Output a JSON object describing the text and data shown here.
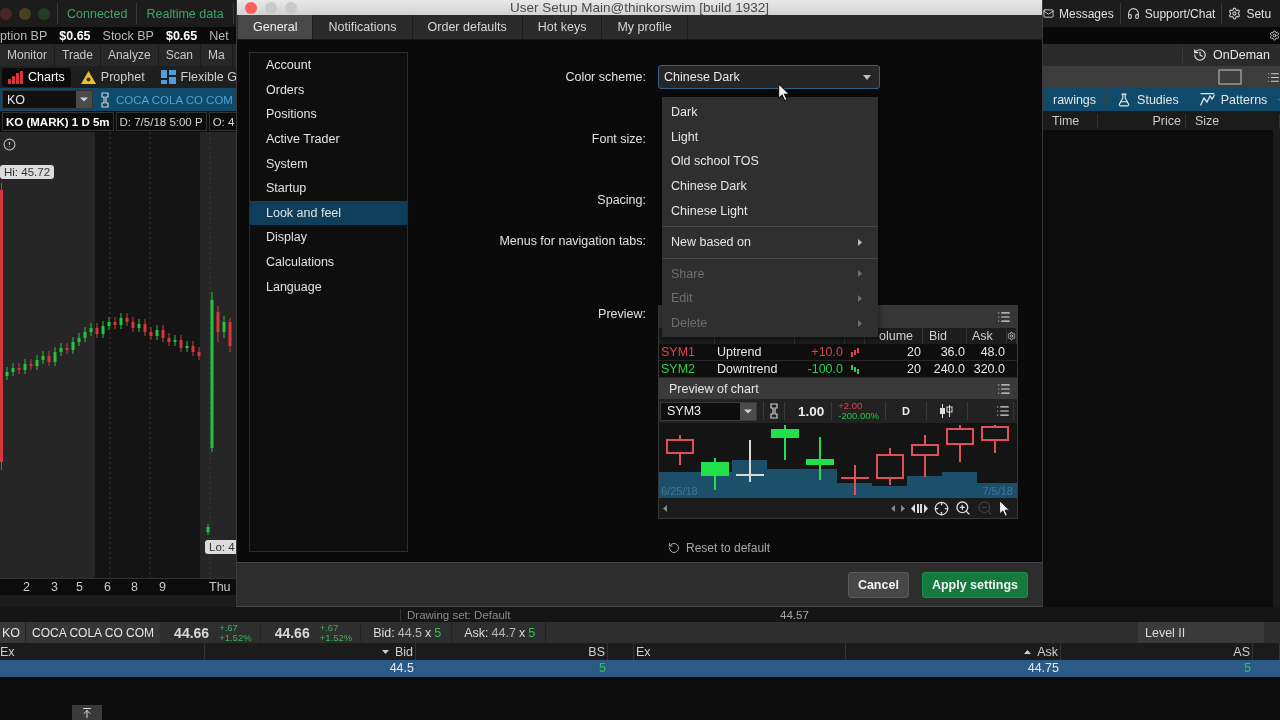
{
  "main_window": {
    "status": {
      "connection": "Connected",
      "feed": "Realtime data"
    },
    "balances": [
      {
        "label": "ption BP",
        "value": "$0.65"
      },
      {
        "label": "Stock BP",
        "value": "$0.65"
      },
      {
        "label": "Net"
      }
    ],
    "header_links": [
      {
        "label": "Messages"
      },
      {
        "label": "Support/Chat"
      },
      {
        "label": "Setu"
      }
    ],
    "main_tabs": [
      {
        "label": "Monitor",
        "selected": false
      },
      {
        "label": "Trade",
        "selected": false
      },
      {
        "label": "Analyze",
        "selected": false
      },
      {
        "label": "Scan",
        "selected": false
      },
      {
        "label": "Ma",
        "selected": false
      }
    ],
    "on_demand": "OnDeman",
    "sub_tabs": [
      {
        "label": "Charts",
        "selected": true
      },
      {
        "label": "Prophet",
        "selected": false
      },
      {
        "label": "Flexible G",
        "selected": false
      }
    ],
    "chart": {
      "symbol": "KO",
      "description": "COCA COLA CO COM",
      "title": "KO (MARK) 1 D 5m",
      "date": "D: 7/5/18 5:00 P",
      "open": "O: 4",
      "high_label": "Hi: 45.72",
      "low_label": "Lo: 4",
      "x_axis": [
        "2",
        "3",
        "5",
        "6",
        "8",
        "9",
        "Thu"
      ],
      "drawing_set": "Drawing set: Default",
      "toolbar": [
        {
          "label": "rawings"
        },
        {
          "label": "Studies"
        },
        {
          "label": "Patterns"
        }
      ]
    },
    "time_and_sales": {
      "columns": [
        "Time",
        "Price",
        "Size"
      ]
    },
    "peek_price": "44.57",
    "quote": {
      "symbol": "KO",
      "description": "COCA COLA CO COM",
      "last": "44.66",
      "net_change": "+.67",
      "percent_change": "+1.52%",
      "mark": "44.66",
      "mark_change": "+.67",
      "mark_percent": "+1.52%",
      "bid": {
        "label": "Bid:",
        "price": "44.5",
        "times": "x",
        "size": "5"
      },
      "ask": {
        "label": "Ask:",
        "price": "44.7",
        "times": "x",
        "size": "5"
      }
    },
    "level2": {
      "tab": "Level II",
      "bid_book": {
        "columns": [
          {
            "label": "Ex",
            "sort_down": false,
            "sort_up": false
          },
          {
            "label": "Bid",
            "sort_down": true,
            "sort_up": false
          },
          {
            "label": "BS",
            "sort_down": false,
            "sort_up": false
          }
        ],
        "rows": [
          {
            "price": "44.5",
            "size": "5",
            "selected": true
          }
        ]
      },
      "ask_book": {
        "columns": [
          {
            "label": "Ex",
            "sort_down": false,
            "sort_up": false
          },
          {
            "label": "Ask",
            "sort_down": false,
            "sort_up": true
          },
          {
            "label": "AS",
            "sort_down": false,
            "sort_up": false
          }
        ],
        "rows": [
          {
            "price": "44.75",
            "size": "5",
            "selected": true
          }
        ]
      }
    }
  },
  "dialog": {
    "title": "User Setup Main@thinkorswim [build 1932]",
    "tabs": [
      {
        "label": "General",
        "selected": true
      },
      {
        "label": "Notifications",
        "selected": false
      },
      {
        "label": "Order defaults",
        "selected": false
      },
      {
        "label": "Hot keys",
        "selected": false
      },
      {
        "label": "My profile",
        "selected": false
      }
    ],
    "sidebar": [
      {
        "label": "Account",
        "selected": false
      },
      {
        "label": "Orders",
        "selected": false
      },
      {
        "label": "Positions",
        "selected": false
      },
      {
        "label": "Active Trader",
        "selected": false
      },
      {
        "label": "System",
        "selected": false
      },
      {
        "label": "Startup",
        "selected": false
      },
      {
        "label": "Look and feel",
        "selected": true
      },
      {
        "label": "Display",
        "selected": false
      },
      {
        "label": "Calculations",
        "selected": false
      },
      {
        "label": "Language",
        "selected": false
      }
    ],
    "color_scheme": {
      "label": "Color scheme:",
      "value": "Chinese Dark",
      "expanded": true,
      "menu_groups": [
        [
          {
            "label": "Dark",
            "kind": "option",
            "disabled": false
          },
          {
            "label": "Light",
            "kind": "option",
            "disabled": false
          },
          {
            "label": "Old school TOS",
            "kind": "option",
            "disabled": false
          },
          {
            "label": "Chinese Dark",
            "kind": "option",
            "disabled": false
          },
          {
            "label": "Chinese Light",
            "kind": "option",
            "disabled": false
          }
        ],
        [
          {
            "label": "New based on",
            "kind": "submenu",
            "disabled": false
          }
        ],
        [
          {
            "label": "Share",
            "kind": "submenu",
            "disabled": true
          },
          {
            "label": "Edit",
            "kind": "submenu",
            "disabled": true
          },
          {
            "label": "Delete",
            "kind": "submenu",
            "disabled": true
          }
        ]
      ]
    },
    "other_settings": [
      {
        "label": "Font size:"
      },
      {
        "label": "Spacing:"
      },
      {
        "label": "Menus for navigation tabs:"
      }
    ],
    "preview": {
      "label": "Preview:",
      "watchlist": {
        "columns": [
          {
            "label": "olume"
          },
          {
            "label": "Bid"
          },
          {
            "label": "Ask"
          }
        ],
        "rows": [
          {
            "symbol": "SYM1",
            "color": "#e0414f",
            "description": "Uptrend",
            "change": "+10.0",
            "volume": "20",
            "bid": "36.0",
            "ask": "48.0"
          },
          {
            "symbol": "SYM2",
            "color": "#2bd04a",
            "description": "Downtrend",
            "change": "-100.0",
            "volume": "20",
            "bid": "240.0",
            "ask": "320.0"
          }
        ]
      },
      "chart": {
        "title": "Preview of chart",
        "symbol": "SYM3",
        "price": "1.00",
        "change": "+2.00",
        "percent": "-200.00%",
        "period": "D",
        "start_date": "6/25/18",
        "end_date": "7/5/18",
        "zoom_out_disabled": true
      }
    },
    "reset": "Reset to default",
    "buttons": [
      {
        "label": "Cancel",
        "kind": "secondary"
      },
      {
        "label": "Apply settings",
        "kind": "primary"
      }
    ]
  }
}
